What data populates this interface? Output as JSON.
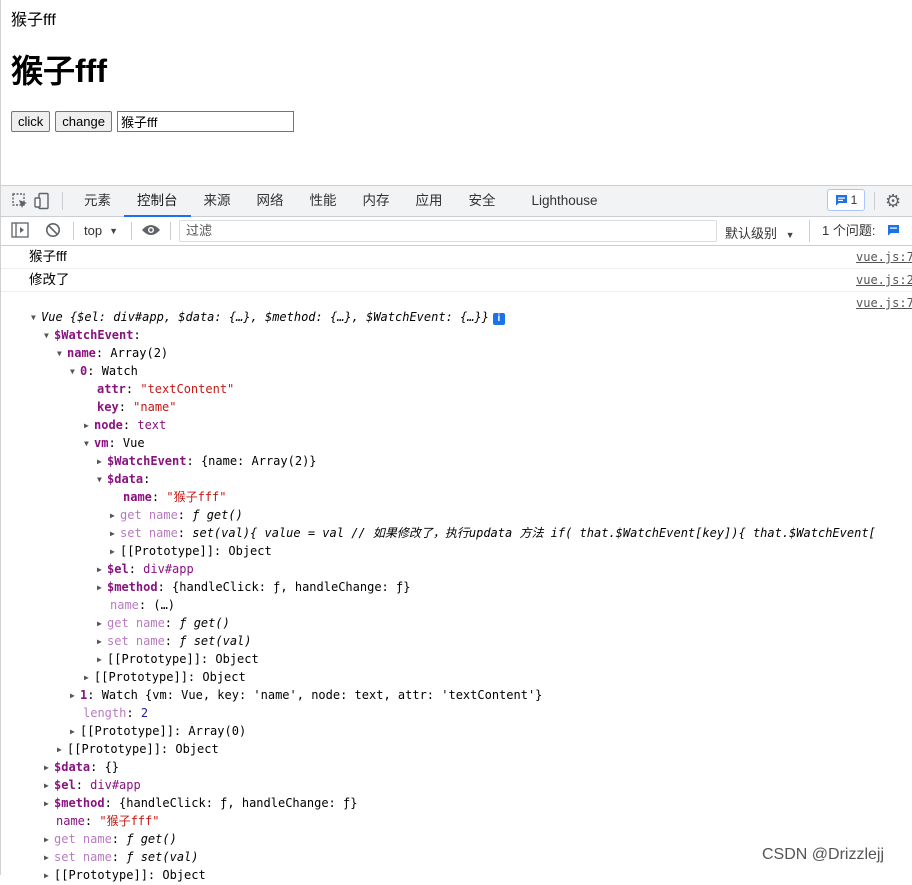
{
  "page": {
    "text": "猴子fff",
    "heading": "猴子fff",
    "click_label": "click",
    "change_label": "change",
    "input_value": "猴子fff"
  },
  "devtools": {
    "tabs": [
      "元素",
      "控制台",
      "来源",
      "网络",
      "性能",
      "内存",
      "应用",
      "安全",
      "Lighthouse"
    ],
    "active_tab": "控制台",
    "issue_count": "1",
    "context": "top",
    "filter_placeholder": "过滤",
    "level": "默认级别",
    "issues_label": "1 个问题:"
  },
  "console": {
    "messages": [
      {
        "text": "猴子fff",
        "src": "vue.js:7"
      },
      {
        "text": "修改了",
        "src": "vue.js:2"
      },
      {
        "text": "",
        "src": "vue.js:7"
      }
    ],
    "summary": "Vue {$el: div#app, $data: {…}, $method: {…}, $WatchEvent: {…}}",
    "tree": [
      {
        "key": "$WatchEvent",
        "val": ""
      },
      {
        "key": "name",
        "val": "Array(2)"
      },
      {
        "key": "0",
        "val": "Watch"
      },
      {
        "key": "attr",
        "val": "\"textContent\""
      },
      {
        "key": "key",
        "val": "\"name\""
      },
      {
        "key": "node",
        "val": "text"
      },
      {
        "key": "vm",
        "val": "Vue"
      },
      {
        "key": "$WatchEvent",
        "val": "{name: Array(2)}"
      },
      {
        "key": "$data",
        "val": ""
      },
      {
        "key": "name",
        "val": "\"猴子fff\""
      },
      {
        "key": "get name",
        "val": "ƒ get()"
      },
      {
        "key": "set name",
        "val": "set(val){ value = val // 如果修改了，执行updata 方法 if( that.$WatchEvent[key]){ that.$WatchEvent["
      },
      {
        "key": "[[Prototype]]",
        "val": "Object"
      },
      {
        "key": "$el",
        "val": "div#app"
      },
      {
        "key": "$method",
        "val": "{handleClick: ƒ, handleChange: ƒ}"
      },
      {
        "key": "name",
        "val": "(…)"
      },
      {
        "key": "get name",
        "val": "ƒ get()"
      },
      {
        "key": "set name",
        "val": "ƒ set(val)"
      },
      {
        "key": "[[Prototype]]",
        "val": "Object"
      },
      {
        "key": "[[Prototype]]",
        "val": "Object"
      },
      {
        "key": "1",
        "val": "Watch {vm: Vue, key: 'name', node: text, attr: 'textContent'}"
      },
      {
        "key": "length",
        "val": "2"
      },
      {
        "key": "[[Prototype]]",
        "val": "Array(0)"
      },
      {
        "key": "[[Prototype]]",
        "val": "Object"
      },
      {
        "key": "$data",
        "val": "{}"
      },
      {
        "key": "$el",
        "val": "div#app"
      },
      {
        "key": "$method",
        "val": "{handleClick: ƒ, handleChange: ƒ}"
      },
      {
        "key": "name",
        "val": "\"猴子fff\""
      },
      {
        "key": "get name",
        "val": "ƒ get()"
      },
      {
        "key": "set name",
        "val": "ƒ set(val)"
      },
      {
        "key": "[[Prototype]]",
        "val": "Object"
      }
    ]
  },
  "watermark": "CSDN @Drizzlejj",
  "colors": {
    "accent": "#1a73e8",
    "key": "#881280",
    "string": "#c41a16",
    "number": "#1a1aa6"
  }
}
